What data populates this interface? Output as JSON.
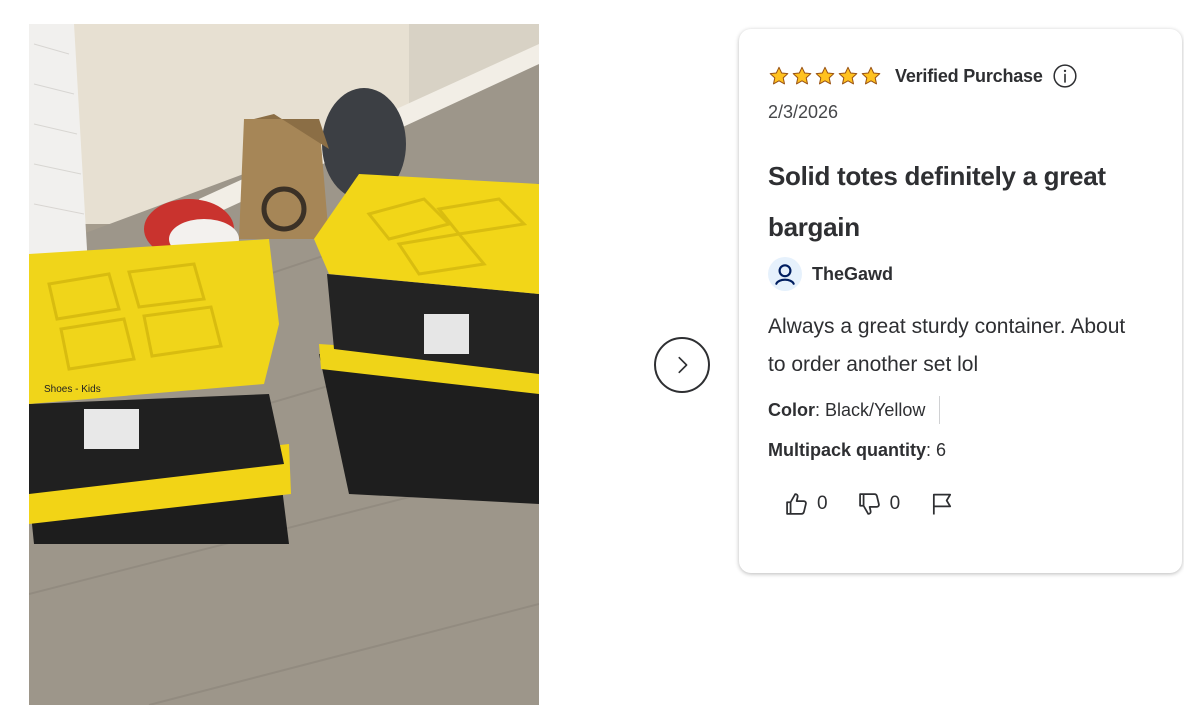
{
  "photo": {
    "alt": "Customer review photo of stacked black and yellow storage totes"
  },
  "navigation": {
    "next_icon": "chevron-right-icon"
  },
  "review": {
    "rating": 5,
    "max_rating": 5,
    "star_color": "#ffc220",
    "verified_label": "Verified Purchase",
    "date": "2/3/2026",
    "title": "Solid totes definitely a great bargain",
    "author": "TheGawd",
    "body": "Always a great sturdy container. About to order another set lol",
    "attributes": [
      {
        "name": "Color",
        "value": ": Black/Yellow"
      },
      {
        "name": "Multipack quantity",
        "value": ": 6"
      }
    ],
    "helpful_count": "0",
    "unhelpful_count": "0"
  },
  "colors": {
    "text": "#2e2f32",
    "avatar_bg": "#e6f1fc",
    "avatar_icon": "#0071dc",
    "accent_dark": "#001e60"
  }
}
